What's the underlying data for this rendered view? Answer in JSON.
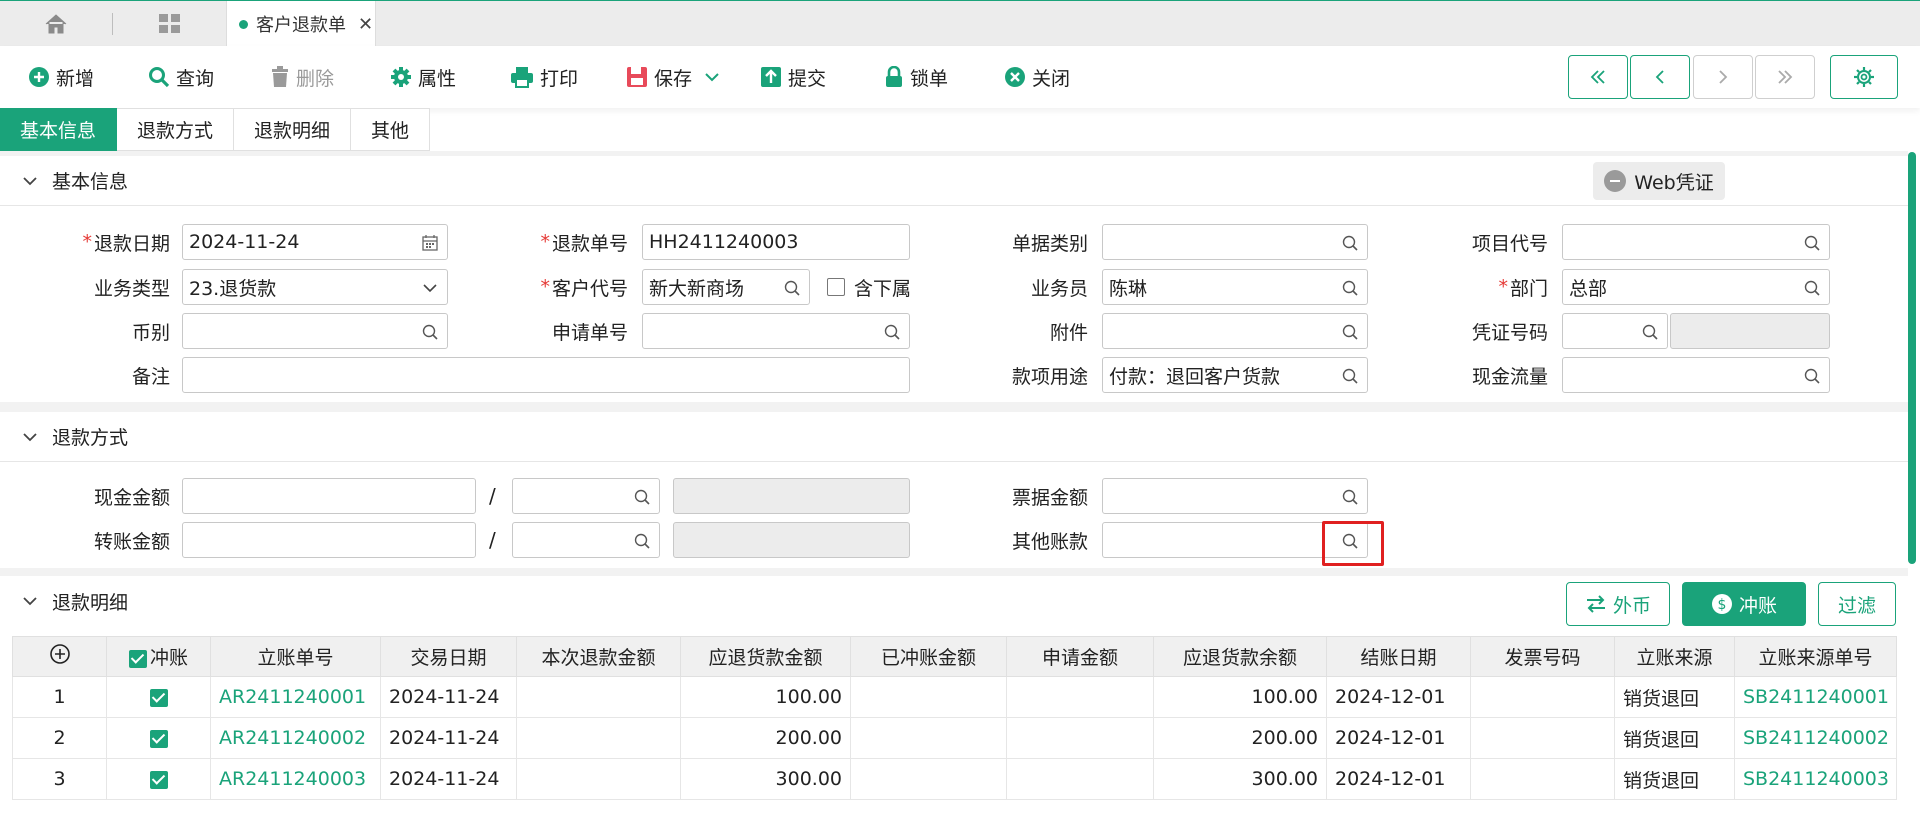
{
  "tabbar": {
    "doc_tab": "客户退款单"
  },
  "toolbar": {
    "new": "新增",
    "query": "查询",
    "delete": "删除",
    "props": "属性",
    "print": "打印",
    "save": "保存",
    "submit": "提交",
    "lock": "锁单",
    "close": "关闭"
  },
  "section_tabs": [
    "基本信息",
    "退款方式",
    "退款明细",
    "其他"
  ],
  "basic": {
    "title": "基本信息",
    "web_voucher": "Web凭证",
    "labels": {
      "refund_date": "退款日期",
      "refund_no": "退款单号",
      "doc_type": "单据类别",
      "project_code": "项目代号",
      "biz_type": "业务类型",
      "customer_code": "客户代号",
      "include_sub": "含下属",
      "salesman": "业务员",
      "dept": "部门",
      "currency": "币别",
      "apply_no": "申请单号",
      "attachment": "附件",
      "voucher_no": "凭证号码",
      "remark": "备注",
      "purpose": "款项用途",
      "cash_flow": "现金流量"
    },
    "values": {
      "refund_date": "2024-11-24",
      "refund_no": "HH2411240003",
      "biz_type": "23.退货款",
      "customer_code": "新大新商场",
      "salesman": "陈琳",
      "dept": "总部",
      "purpose": "付款：退回客户货款"
    }
  },
  "method": {
    "title": "退款方式",
    "labels": {
      "cash": "现金金额",
      "transfer": "转账金额",
      "bill": "票据金额",
      "other": "其他账款"
    },
    "slash": "/"
  },
  "detail": {
    "title": "退款明细",
    "btn_foreign": "外币",
    "btn_offset": "冲账",
    "btn_filter": "过滤",
    "columns": [
      "冲账",
      "立账单号",
      "交易日期",
      "本次退款金额",
      "应退货款金额",
      "已冲账金额",
      "申请金额",
      "应退货款余额",
      "结账日期",
      "发票号码",
      "立账来源",
      "立账来源单号"
    ],
    "rows": [
      {
        "no": "1",
        "ar_no": "AR2411240001",
        "date": "2024-11-24",
        "this_refund": "",
        "due": "100.00",
        "offset": "",
        "apply": "",
        "balance": "100.00",
        "settle_date": "2024-12-01",
        "invoice": "",
        "source": "销货退回",
        "source_no": "SB2411240001"
      },
      {
        "no": "2",
        "ar_no": "AR2411240002",
        "date": "2024-11-24",
        "this_refund": "",
        "due": "200.00",
        "offset": "",
        "apply": "",
        "balance": "200.00",
        "settle_date": "2024-12-01",
        "invoice": "",
        "source": "销货退回",
        "source_no": "SB2411240002"
      },
      {
        "no": "3",
        "ar_no": "AR2411240003",
        "date": "2024-11-24",
        "this_refund": "",
        "due": "300.00",
        "offset": "",
        "apply": "",
        "balance": "300.00",
        "settle_date": "2024-12-01",
        "invoice": "",
        "source": "销货退回",
        "source_no": "SB2411240003"
      }
    ]
  }
}
